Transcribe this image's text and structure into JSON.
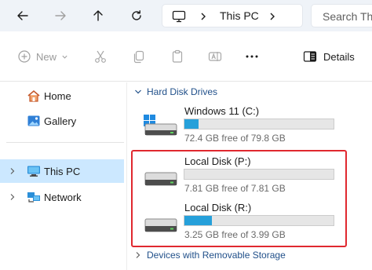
{
  "address": {
    "location": "This PC",
    "search_placeholder": "Search Th"
  },
  "toolbar": {
    "new_label": "New",
    "details_label": "Details"
  },
  "sidebar": {
    "items": [
      {
        "label": "Home"
      },
      {
        "label": "Gallery"
      },
      {
        "label": "This PC"
      },
      {
        "label": "Network"
      }
    ]
  },
  "main": {
    "hard_disk_group": "Hard Disk Drives",
    "removable_group": "Devices with Removable Storage",
    "drives": [
      {
        "name": "Windows 11 (C:)",
        "free_text": "72.4 GB free of 79.8 GB",
        "used_fraction": 0.093
      },
      {
        "name": "Local Disk (P:)",
        "free_text": "7.81 GB free of 7.81 GB",
        "used_fraction": 0.0
      },
      {
        "name": "Local Disk (R:)",
        "free_text": "3.25 GB free of 3.99 GB",
        "used_fraction": 0.185
      }
    ]
  },
  "colors": {
    "accent": "#26a0da",
    "selection": "#cce8ff",
    "highlight": "#e0282f"
  }
}
